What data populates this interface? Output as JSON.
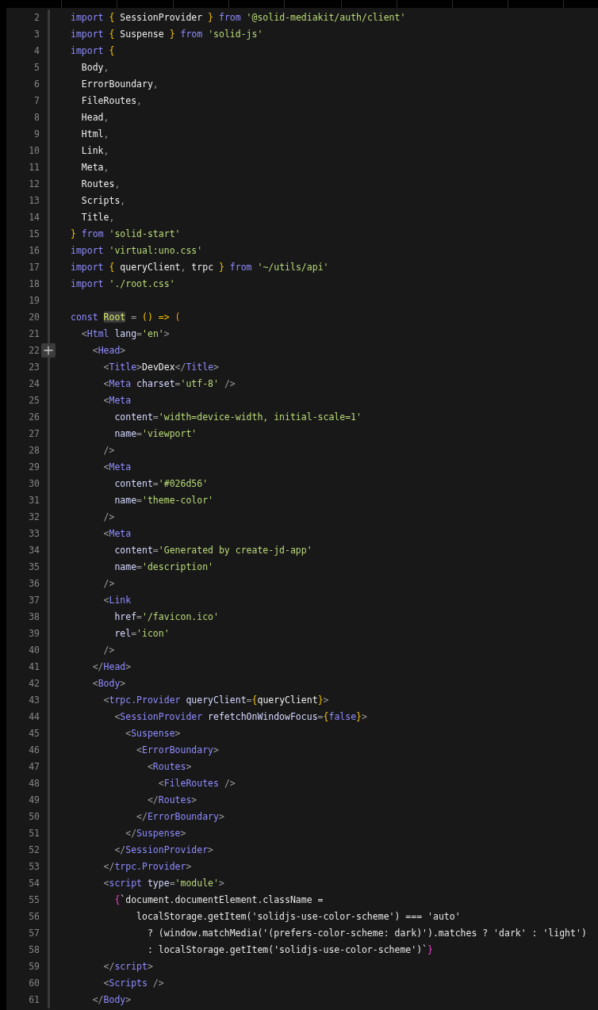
{
  "lines": [
    {
      "number": "2",
      "hovered": false,
      "tokens": [
        {
          "kind": "keyword",
          "text": "import "
        },
        {
          "kind": "brace",
          "text": "{ "
        },
        {
          "kind": "name",
          "text": "SessionProvider "
        },
        {
          "kind": "brace",
          "text": "} "
        },
        {
          "kind": "keyword",
          "text": "from "
        },
        {
          "kind": "string",
          "text": "'@solid-mediakit/auth/client'"
        }
      ]
    },
    {
      "number": "3",
      "hovered": false,
      "tokens": [
        {
          "kind": "keyword",
          "text": "import "
        },
        {
          "kind": "brace",
          "text": "{ "
        },
        {
          "kind": "name",
          "text": "Suspense "
        },
        {
          "kind": "brace",
          "text": "} "
        },
        {
          "kind": "keyword",
          "text": "from "
        },
        {
          "kind": "string",
          "text": "'solid-js'"
        }
      ]
    },
    {
      "number": "4",
      "hovered": false,
      "tokens": [
        {
          "kind": "keyword",
          "text": "import "
        },
        {
          "kind": "brace",
          "text": "{"
        }
      ]
    },
    {
      "number": "5",
      "hovered": false,
      "tokens": [
        {
          "kind": "name",
          "text": "  Body"
        },
        {
          "kind": "punct",
          "text": ","
        }
      ]
    },
    {
      "number": "6",
      "hovered": false,
      "tokens": [
        {
          "kind": "name",
          "text": "  ErrorBoundary"
        },
        {
          "kind": "punct",
          "text": ","
        }
      ]
    },
    {
      "number": "7",
      "hovered": false,
      "tokens": [
        {
          "kind": "name",
          "text": "  FileRoutes"
        },
        {
          "kind": "punct",
          "text": ","
        }
      ]
    },
    {
      "number": "8",
      "hovered": false,
      "tokens": [
        {
          "kind": "name",
          "text": "  Head"
        },
        {
          "kind": "punct",
          "text": ","
        }
      ]
    },
    {
      "number": "9",
      "hovered": false,
      "tokens": [
        {
          "kind": "name",
          "text": "  Html"
        },
        {
          "kind": "punct",
          "text": ","
        }
      ]
    },
    {
      "number": "10",
      "hovered": false,
      "tokens": [
        {
          "kind": "name",
          "text": "  Link"
        },
        {
          "kind": "punct",
          "text": ","
        }
      ]
    },
    {
      "number": "11",
      "hovered": false,
      "tokens": [
        {
          "kind": "name",
          "text": "  Meta"
        },
        {
          "kind": "punct",
          "text": ","
        }
      ]
    },
    {
      "number": "12",
      "hovered": false,
      "tokens": [
        {
          "kind": "name",
          "text": "  Routes"
        },
        {
          "kind": "punct",
          "text": ","
        }
      ]
    },
    {
      "number": "13",
      "hovered": false,
      "tokens": [
        {
          "kind": "name",
          "text": "  Scripts"
        },
        {
          "kind": "punct",
          "text": ","
        }
      ]
    },
    {
      "number": "14",
      "hovered": false,
      "tokens": [
        {
          "kind": "name",
          "text": "  Title"
        },
        {
          "kind": "punct",
          "text": ","
        }
      ]
    },
    {
      "number": "15",
      "hovered": false,
      "tokens": [
        {
          "kind": "brace",
          "text": "} "
        },
        {
          "kind": "keyword",
          "text": "from "
        },
        {
          "kind": "string",
          "text": "'solid-start'"
        }
      ]
    },
    {
      "number": "16",
      "hovered": false,
      "tokens": [
        {
          "kind": "keyword",
          "text": "import "
        },
        {
          "kind": "string",
          "text": "'virtual:uno.css'"
        }
      ]
    },
    {
      "number": "17",
      "hovered": false,
      "tokens": [
        {
          "kind": "keyword",
          "text": "import "
        },
        {
          "kind": "brace",
          "text": "{ "
        },
        {
          "kind": "name",
          "text": "queryClient"
        },
        {
          "kind": "punct",
          "text": ", "
        },
        {
          "kind": "name",
          "text": "trpc "
        },
        {
          "kind": "brace",
          "text": "} "
        },
        {
          "kind": "keyword",
          "text": "from "
        },
        {
          "kind": "string",
          "text": "'~/utils/api'"
        }
      ]
    },
    {
      "number": "18",
      "hovered": false,
      "tokens": [
        {
          "kind": "keyword",
          "text": "import "
        },
        {
          "kind": "string",
          "text": "'./root.css'"
        }
      ]
    },
    {
      "number": "19",
      "hovered": false
    },
    {
      "number": "20",
      "hovered": false,
      "tokens": [
        {
          "kind": "keyword",
          "text": "const "
        },
        {
          "kind": "highlight",
          "text": "Root"
        },
        {
          "kind": "punct",
          "text": " = "
        },
        {
          "kind": "brace",
          "text": "() => "
        },
        {
          "kind": "paren",
          "text": "("
        }
      ]
    },
    {
      "number": "21",
      "hovered": false,
      "tokens": [
        {
          "kind": "punct",
          "text": "  <"
        },
        {
          "kind": "tag",
          "text": "Html"
        },
        {
          "kind": "attr",
          "text": " lang"
        },
        {
          "kind": "punct",
          "text": "="
        },
        {
          "kind": "string",
          "text": "'en'"
        },
        {
          "kind": "punct",
          "text": ">"
        }
      ]
    },
    {
      "number": "22",
      "hovered": true,
      "tokens": [
        {
          "kind": "punct",
          "text": "    <"
        },
        {
          "kind": "tag",
          "text": "Head"
        },
        {
          "kind": "punct",
          "text": ">"
        }
      ]
    },
    {
      "number": "23",
      "hovered": false,
      "tokens": [
        {
          "kind": "punct",
          "text": "      <"
        },
        {
          "kind": "tag",
          "text": "Title"
        },
        {
          "kind": "punct",
          "text": ">"
        },
        {
          "kind": "name",
          "text": "DevDex"
        },
        {
          "kind": "punct",
          "text": "</"
        },
        {
          "kind": "tag",
          "text": "Title"
        },
        {
          "kind": "punct",
          "text": ">"
        }
      ]
    },
    {
      "number": "24",
      "hovered": false,
      "tokens": [
        {
          "kind": "punct",
          "text": "      <"
        },
        {
          "kind": "tag",
          "text": "Meta"
        },
        {
          "kind": "attr",
          "text": " charset"
        },
        {
          "kind": "punct",
          "text": "="
        },
        {
          "kind": "string",
          "text": "'utf-8'"
        },
        {
          "kind": "punct",
          "text": " />"
        }
      ]
    },
    {
      "number": "25",
      "hovered": false,
      "tokens": [
        {
          "kind": "punct",
          "text": "      <"
        },
        {
          "kind": "tag",
          "text": "Meta"
        }
      ]
    },
    {
      "number": "26",
      "hovered": false,
      "tokens": [
        {
          "kind": "attr",
          "text": "        content"
        },
        {
          "kind": "punct",
          "text": "="
        },
        {
          "kind": "string",
          "text": "'width=device-width, initial-scale=1'"
        }
      ]
    },
    {
      "number": "27",
      "hovered": false,
      "tokens": [
        {
          "kind": "attr",
          "text": "        name"
        },
        {
          "kind": "punct",
          "text": "="
        },
        {
          "kind": "string",
          "text": "'viewport'"
        }
      ]
    },
    {
      "number": "28",
      "hovered": false,
      "tokens": [
        {
          "kind": "punct",
          "text": "      />"
        }
      ]
    },
    {
      "number": "29",
      "hovered": false,
      "tokens": [
        {
          "kind": "punct",
          "text": "      <"
        },
        {
          "kind": "tag",
          "text": "Meta"
        }
      ]
    },
    {
      "number": "30",
      "hovered": false,
      "tokens": [
        {
          "kind": "attr",
          "text": "        content"
        },
        {
          "kind": "punct",
          "text": "="
        },
        {
          "kind": "string",
          "text": "'#026d56'"
        }
      ]
    },
    {
      "number": "31",
      "hovered": false,
      "tokens": [
        {
          "kind": "attr",
          "text": "        name"
        },
        {
          "kind": "punct",
          "text": "="
        },
        {
          "kind": "string",
          "text": "'theme-color'"
        }
      ]
    },
    {
      "number": "32",
      "hovered": false,
      "tokens": [
        {
          "kind": "punct",
          "text": "      />"
        }
      ]
    },
    {
      "number": "33",
      "hovered": false,
      "tokens": [
        {
          "kind": "punct",
          "text": "      <"
        },
        {
          "kind": "tag",
          "text": "Meta"
        }
      ]
    },
    {
      "number": "34",
      "hovered": false,
      "tokens": [
        {
          "kind": "attr",
          "text": "        content"
        },
        {
          "kind": "punct",
          "text": "="
        },
        {
          "kind": "string",
          "text": "'Generated by create-jd-app'"
        }
      ]
    },
    {
      "number": "35",
      "hovered": false,
      "tokens": [
        {
          "kind": "attr",
          "text": "        name"
        },
        {
          "kind": "punct",
          "text": "="
        },
        {
          "kind": "string",
          "text": "'description'"
        }
      ]
    },
    {
      "number": "36",
      "hovered": false,
      "tokens": [
        {
          "kind": "punct",
          "text": "      />"
        }
      ]
    },
    {
      "number": "37",
      "hovered": false,
      "tokens": [
        {
          "kind": "punct",
          "text": "      <"
        },
        {
          "kind": "tag",
          "text": "Link"
        }
      ]
    },
    {
      "number": "38",
      "hovered": false,
      "tokens": [
        {
          "kind": "attr",
          "text": "        href"
        },
        {
          "kind": "punct",
          "text": "="
        },
        {
          "kind": "string",
          "text": "'/favicon.ico'"
        }
      ]
    },
    {
      "number": "39",
      "hovered": false,
      "tokens": [
        {
          "kind": "attr",
          "text": "        rel"
        },
        {
          "kind": "punct",
          "text": "="
        },
        {
          "kind": "string",
          "text": "'icon'"
        }
      ]
    },
    {
      "number": "40",
      "hovered": false,
      "tokens": [
        {
          "kind": "punct",
          "text": "      />"
        }
      ]
    },
    {
      "number": "41",
      "hovered": false,
      "tokens": [
        {
          "kind": "punct",
          "text": "    </"
        },
        {
          "kind": "tag",
          "text": "Head"
        },
        {
          "kind": "punct",
          "text": ">"
        }
      ]
    },
    {
      "number": "42",
      "hovered": false,
      "tokens": [
        {
          "kind": "punct",
          "text": "    <"
        },
        {
          "kind": "tag",
          "text": "Body"
        },
        {
          "kind": "punct",
          "text": ">"
        }
      ]
    },
    {
      "number": "43",
      "hovered": false,
      "tokens": [
        {
          "kind": "punct",
          "text": "      <"
        },
        {
          "kind": "tag",
          "text": "trpc.Provider"
        },
        {
          "kind": "attr",
          "text": " queryClient"
        },
        {
          "kind": "punct",
          "text": "="
        },
        {
          "kind": "brace",
          "text": "{"
        },
        {
          "kind": "name",
          "text": "queryClient"
        },
        {
          "kind": "brace",
          "text": "}"
        },
        {
          "kind": "punct",
          "text": ">"
        }
      ]
    },
    {
      "number": "44",
      "hovered": false,
      "tokens": [
        {
          "kind": "punct",
          "text": "        <"
        },
        {
          "kind": "tag",
          "text": "SessionProvider"
        },
        {
          "kind": "attr",
          "text": " refetchOnWindowFocus"
        },
        {
          "kind": "punct",
          "text": "="
        },
        {
          "kind": "brace",
          "text": "{"
        },
        {
          "kind": "keyword",
          "text": "false"
        },
        {
          "kind": "brace",
          "text": "}"
        },
        {
          "kind": "punct",
          "text": ">"
        }
      ]
    },
    {
      "number": "45",
      "hovered": false,
      "tokens": [
        {
          "kind": "punct",
          "text": "          <"
        },
        {
          "kind": "tag",
          "text": "Suspense"
        },
        {
          "kind": "punct",
          "text": ">"
        }
      ]
    },
    {
      "number": "46",
      "hovered": false,
      "tokens": [
        {
          "kind": "punct",
          "text": "            <"
        },
        {
          "kind": "tag",
          "text": "ErrorBoundary"
        },
        {
          "kind": "punct",
          "text": ">"
        }
      ]
    },
    {
      "number": "47",
      "hovered": false,
      "tokens": [
        {
          "kind": "punct",
          "text": "              <"
        },
        {
          "kind": "tag",
          "text": "Routes"
        },
        {
          "kind": "punct",
          "text": ">"
        }
      ]
    },
    {
      "number": "48",
      "hovered": false,
      "tokens": [
        {
          "kind": "punct",
          "text": "                <"
        },
        {
          "kind": "tag",
          "text": "FileRoutes"
        },
        {
          "kind": "punct",
          "text": " />"
        }
      ]
    },
    {
      "number": "49",
      "hovered": false,
      "tokens": [
        {
          "kind": "punct",
          "text": "              </"
        },
        {
          "kind": "tag",
          "text": "Routes"
        },
        {
          "kind": "punct",
          "text": ">"
        }
      ]
    },
    {
      "number": "50",
      "hovered": false,
      "tokens": [
        {
          "kind": "punct",
          "text": "            </"
        },
        {
          "kind": "tag",
          "text": "ErrorBoundary"
        },
        {
          "kind": "punct",
          "text": ">"
        }
      ]
    },
    {
      "number": "51",
      "hovered": false,
      "tokens": [
        {
          "kind": "punct",
          "text": "          </"
        },
        {
          "kind": "tag",
          "text": "Suspense"
        },
        {
          "kind": "punct",
          "text": ">"
        }
      ]
    },
    {
      "number": "52",
      "hovered": false,
      "tokens": [
        {
          "kind": "punct",
          "text": "        </"
        },
        {
          "kind": "tag",
          "text": "SessionProvider"
        },
        {
          "kind": "punct",
          "text": ">"
        }
      ]
    },
    {
      "number": "53",
      "hovered": false,
      "tokens": [
        {
          "kind": "punct",
          "text": "      </"
        },
        {
          "kind": "tag",
          "text": "trpc.Provider"
        },
        {
          "kind": "punct",
          "text": ">"
        }
      ]
    },
    {
      "number": "54",
      "hovered": false,
      "tokens": [
        {
          "kind": "punct",
          "text": "      <"
        },
        {
          "kind": "tag",
          "text": "script"
        },
        {
          "kind": "attr",
          "text": " type"
        },
        {
          "kind": "punct",
          "text": "="
        },
        {
          "kind": "string",
          "text": "'module'"
        },
        {
          "kind": "punct",
          "text": ">"
        }
      ]
    },
    {
      "number": "55",
      "hovered": false,
      "tokens": [
        {
          "kind": "pink",
          "text": "        {"
        },
        {
          "kind": "template",
          "text": "`document.documentElement.className ="
        }
      ]
    },
    {
      "number": "56",
      "hovered": false,
      "tokens": [
        {
          "kind": "template",
          "text": "            localStorage.getItem('solidjs-use-color-scheme') === 'auto'"
        }
      ]
    },
    {
      "number": "57",
      "hovered": false,
      "tokens": [
        {
          "kind": "template",
          "text": "              ? (window.matchMedia('(prefers-color-scheme: dark)').matches ? 'dark' : 'light')"
        }
      ]
    },
    {
      "number": "58",
      "hovered": false,
      "tokens": [
        {
          "kind": "template",
          "text": "              : localStorage.getItem('solidjs-use-color-scheme')`"
        },
        {
          "kind": "pink",
          "text": "}"
        }
      ]
    },
    {
      "number": "59",
      "hovered": false,
      "tokens": [
        {
          "kind": "punct",
          "text": "      </"
        },
        {
          "kind": "tag",
          "text": "script"
        },
        {
          "kind": "punct",
          "text": ">"
        }
      ]
    },
    {
      "number": "60",
      "hovered": false,
      "tokens": [
        {
          "kind": "punct",
          "text": "      <"
        },
        {
          "kind": "tag",
          "text": "Scripts"
        },
        {
          "kind": "punct",
          "text": " />"
        }
      ]
    },
    {
      "number": "61",
      "hovered": false,
      "tokens": [
        {
          "kind": "punct",
          "text": "    </"
        },
        {
          "kind": "tag",
          "text": "Body"
        },
        {
          "kind": "punct",
          "text": ">"
        }
      ]
    }
  ]
}
